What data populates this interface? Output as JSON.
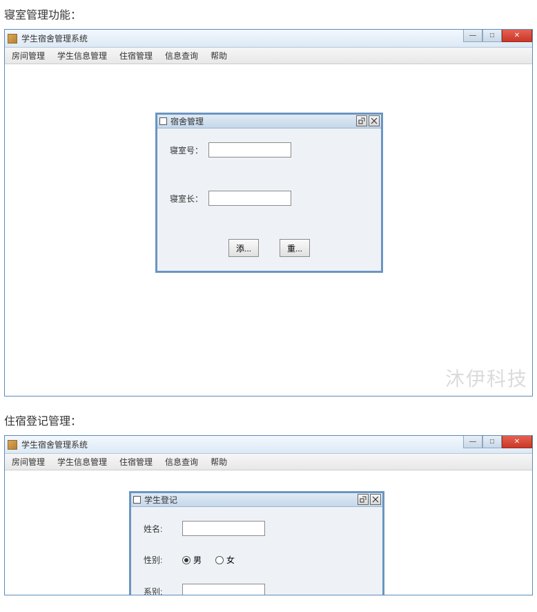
{
  "section1": {
    "title": "寝室管理功能："
  },
  "section2": {
    "title": "住宿登记管理："
  },
  "app": {
    "title1": "学生宿舍管理系统",
    "title2": "学生宿舍管理系统",
    "menu": {
      "room": "房间管理",
      "student": "学生信息管理",
      "stay": "住宿管理",
      "query": "信息查询",
      "help": "帮助"
    }
  },
  "dialog1": {
    "title": "宿舍管理",
    "field_room": "寝室号：",
    "field_leader": "寝室长：",
    "value_room": "",
    "value_leader": "",
    "btn_add": "添...",
    "btn_reset": "重..."
  },
  "dialog2": {
    "title": "学生登记",
    "field_name": "姓名:",
    "field_sex": "性别:",
    "field_dept": "系别:",
    "value_name": "",
    "value_dept": "",
    "opt_male": "男",
    "opt_female": "女"
  },
  "watermark": "沐伊科技"
}
